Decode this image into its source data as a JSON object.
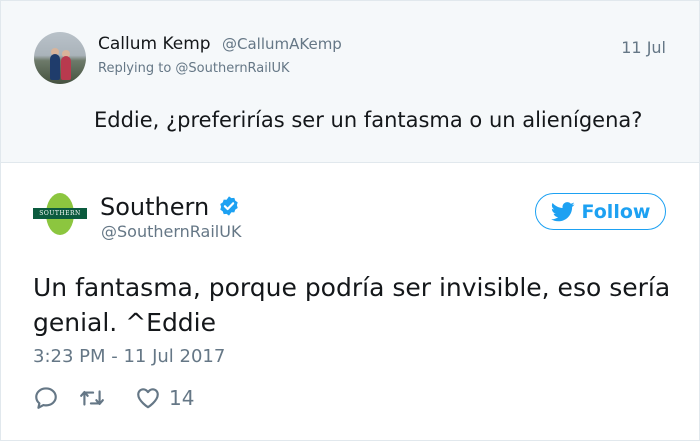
{
  "reply": {
    "author_name": "Callum Kemp",
    "author_handle": "@CallumAKemp",
    "date": "11 Jul",
    "replying_to": "Replying to @SouthernRailUK",
    "text": "Eddie, ¿preferirías ser un fantasma o un alienígena?"
  },
  "main": {
    "author_name": "Southern",
    "author_handle": "@SouthernRailUK",
    "logo_text": "SOUTHERN",
    "follow_label": "Follow",
    "text": "Un fantasma, porque podría ser invisible, eso sería genial. ^Eddie",
    "timestamp": "3:23 PM - 11 Jul 2017",
    "like_count": "14"
  },
  "colors": {
    "accent": "#1da1f2",
    "muted": "#657786",
    "reply_bg": "#f5f8fa",
    "southern_green": "#0b5b3e",
    "southern_lime": "#8cc63f"
  },
  "icons": [
    "verified-badge-icon",
    "twitter-bird-icon",
    "reply-icon",
    "retweet-icon",
    "heart-icon"
  ]
}
